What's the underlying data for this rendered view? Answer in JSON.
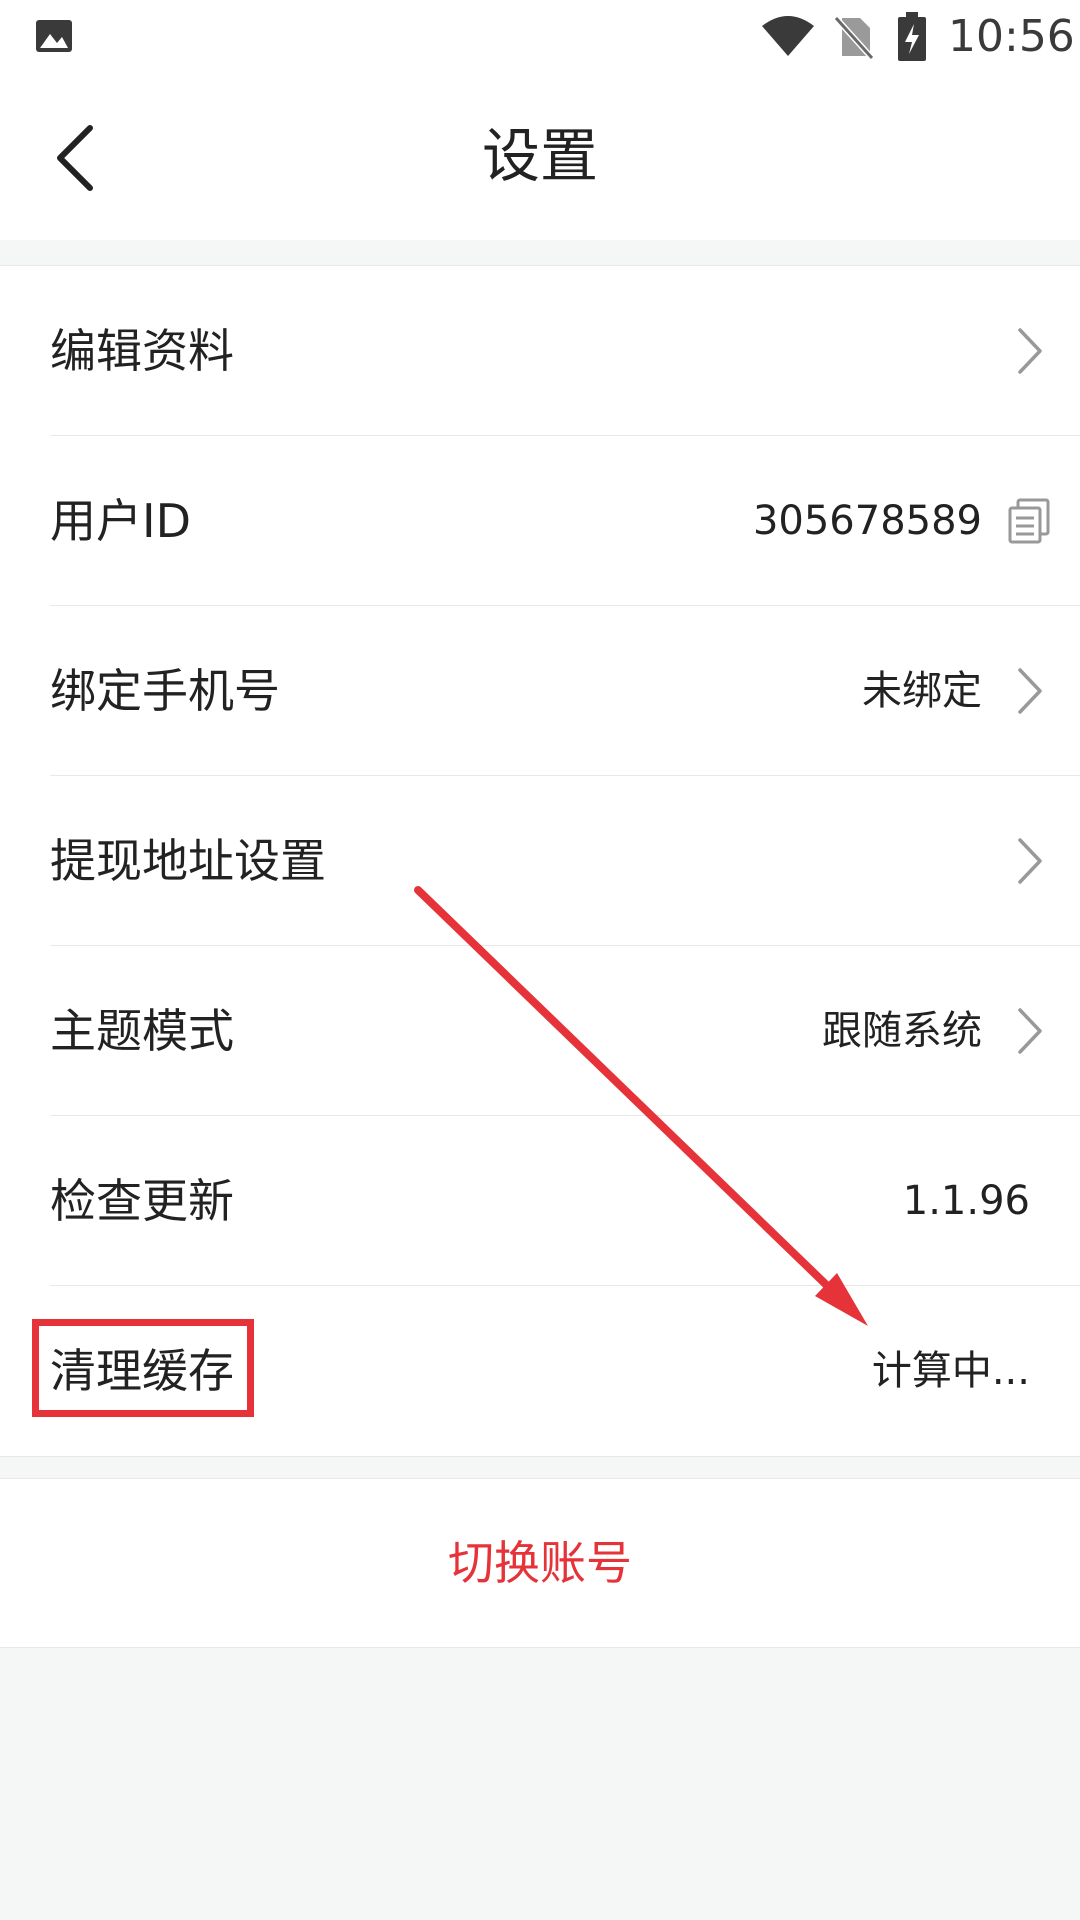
{
  "status_bar": {
    "time": "10:56",
    "icons": [
      "gallery-icon",
      "wifi-icon",
      "no-sim-icon",
      "battery-charging-icon"
    ]
  },
  "header": {
    "title": "设置",
    "back_icon": "chevron-left-icon"
  },
  "settings": {
    "edit_profile": {
      "label": "编辑资料"
    },
    "user_id": {
      "label": "用户ID",
      "value": "305678589"
    },
    "bind_phone": {
      "label": "绑定手机号",
      "value": "未绑定"
    },
    "withdraw_address": {
      "label": "提现地址设置"
    },
    "theme_mode": {
      "label": "主题模式",
      "value": "跟随系统"
    },
    "check_update": {
      "label": "检查更新",
      "value": "1.1.96"
    },
    "clear_cache": {
      "label": "清理缓存",
      "value": "计算中..."
    }
  },
  "actions": {
    "switch_account": "切换账号"
  },
  "colors": {
    "accent_red": "#e53339",
    "background": "#f5f6f6",
    "surface": "#ffffff",
    "divider": "#e8e8e8"
  }
}
